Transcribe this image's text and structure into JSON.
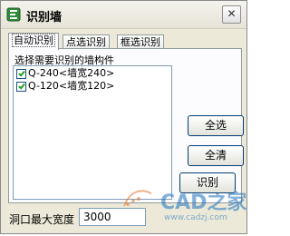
{
  "window": {
    "title": "识别墙",
    "close_symbol": "✕",
    "app_icon": "app-icon"
  },
  "tabs": [
    {
      "label": "自动识别",
      "active": true
    },
    {
      "label": "点选识别",
      "active": false
    },
    {
      "label": "框选识别",
      "active": false
    }
  ],
  "panel": {
    "label": "选择需要识别的墙构件",
    "items": [
      {
        "label": "Q-240<墙宽240>",
        "checked": true
      },
      {
        "label": "Q-120<墙宽120>",
        "checked": true
      }
    ],
    "select_all_label": "全选",
    "clear_all_label": "全清",
    "identify_label": "识别"
  },
  "opening_width": {
    "label": "洞口最大宽度",
    "value": "3000"
  },
  "watermark": {
    "brand": "CAD之家",
    "url": "www.cadzj.com"
  }
}
